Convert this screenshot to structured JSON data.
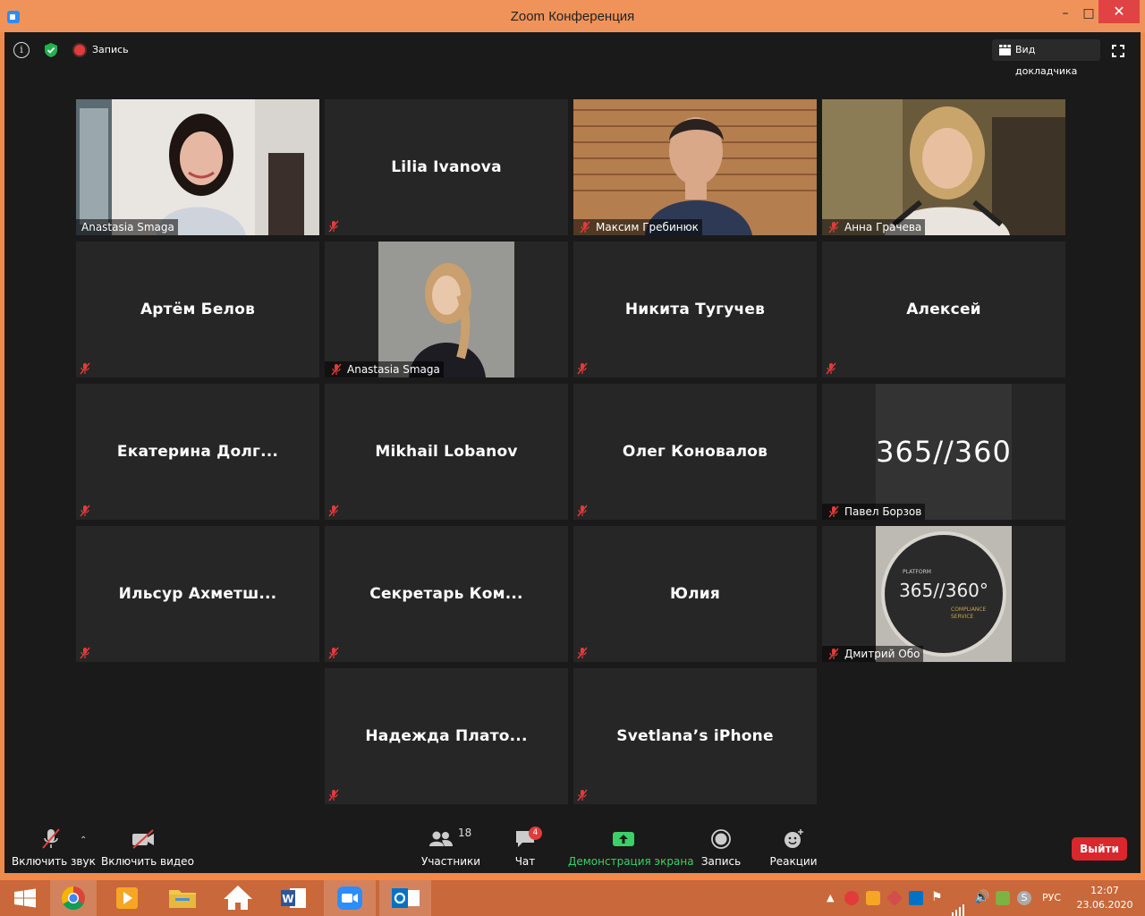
{
  "window": {
    "title": "Zoom Конференция"
  },
  "topbar": {
    "record_label": "Запись",
    "speaker_view_label": "Вид докладчика"
  },
  "tiles": [
    {
      "caption": "Anastasia Smaga",
      "active": true,
      "video": "woman-dark-hair"
    },
    {
      "name": "Lilia Ivanova"
    },
    {
      "caption": "Максим Гребинюк",
      "video": "man-suit"
    },
    {
      "caption": "Анна Грачева",
      "video": "woman-blonde"
    },
    {
      "name": "Артём Белов"
    },
    {
      "caption": "Anastasia Smaga",
      "video": "woman-portrait"
    },
    {
      "name": "Никита Тугучев"
    },
    {
      "name": "Алексей"
    },
    {
      "name": "Екатерина  Долг..."
    },
    {
      "name": "Mikhail Lobanov"
    },
    {
      "name": "Олег Коновалов"
    },
    {
      "caption": "Павел Борзов",
      "logo_text": "365//360"
    },
    {
      "name": "Ильсур  Ахметш..."
    },
    {
      "name": "Секретарь  Ком..."
    },
    {
      "name": "Юлия"
    },
    {
      "caption": "Дмитрий Обо",
      "badge": {
        "top": "PLATFORM",
        "main_left": "365",
        "main_right": "360°",
        "sub1": "COMPLIANCE",
        "sub2": "SERVICE"
      }
    },
    {
      "name": "Надежда  Плато..."
    },
    {
      "name": "Svetlana’s iPhone"
    }
  ],
  "toolbar": {
    "unmute_label": "Включить звук",
    "start_video_label": "Включить видео",
    "participants_label": "Участники",
    "participants_count": "18",
    "chat_label": "Чат",
    "chat_badge": "4",
    "share_label": "Демонстрация экрана",
    "record_label": "Запись",
    "reactions_label": "Реакции",
    "leave_label": "Выйти"
  },
  "taskbar": {
    "apps": [
      "windows-start-icon",
      "chrome-icon",
      "media-player-icon",
      "file-explorer-icon",
      "home-icon",
      "word-icon",
      "zoom-icon",
      "outlook-icon"
    ],
    "lang": "РУС",
    "time": "12:07",
    "date": "23.06.2020"
  },
  "colors": {
    "active_speaker": "#c8e64b",
    "leave": "#d9272e",
    "share": "#3ad06a",
    "window_frame": "#f08a4b"
  }
}
